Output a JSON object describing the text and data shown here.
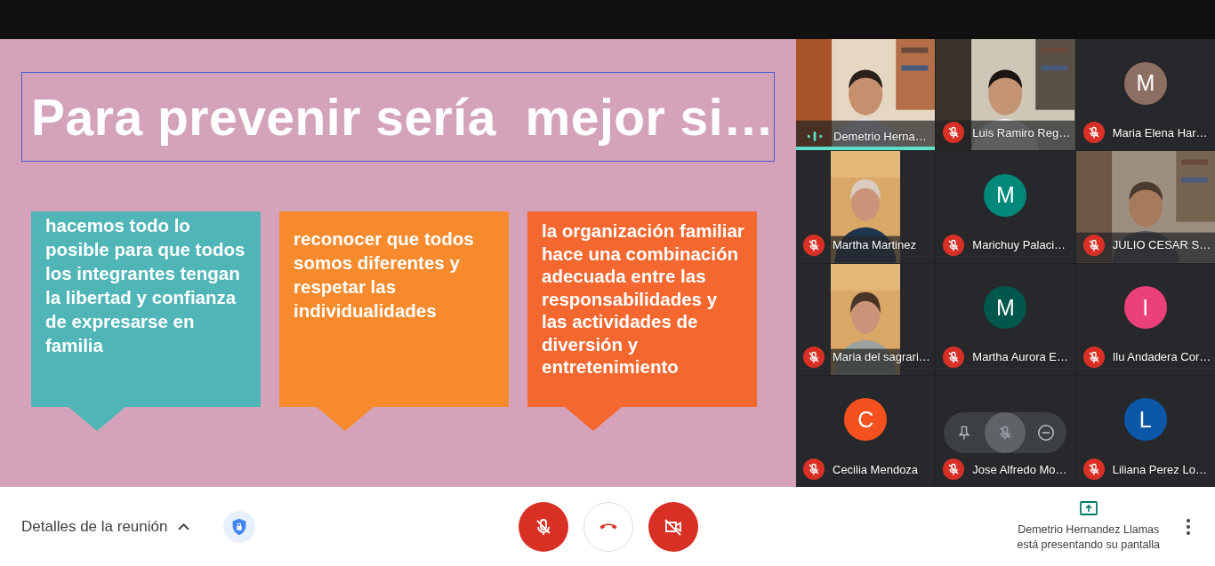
{
  "slide": {
    "title": "Para prevenir sería  mejor si…",
    "title_selected": true,
    "cards": [
      {
        "text": "hacemos todo lo posible para que todos los integrantes tengan la libertad y confianza de expresarse en familia",
        "color": "#4fb5b7"
      },
      {
        "text": "reconocer que todos somos diferentes y respetar las individualidades",
        "color": "#f78a2c"
      },
      {
        "text": "la organización familiar hace una combinación adecuada entre las responsabilidades y las actividades de diversión y entretenimiento",
        "color": "#f4672f"
      }
    ]
  },
  "participants": [
    {
      "name": "Demetrio Herna…",
      "kind": "video",
      "muted": false,
      "speaking": true
    },
    {
      "name": "Luis Ramiro Reg…",
      "kind": "video",
      "muted": true,
      "speaking": false
    },
    {
      "name": "Maria Elena Har…",
      "kind": "avatar",
      "initial": "M",
      "color": "#8d6e63",
      "muted": true,
      "speaking": false
    },
    {
      "name": "Martha Martinez",
      "kind": "portrait",
      "muted": true,
      "speaking": false
    },
    {
      "name": "Marichuy Palaci…",
      "kind": "avatar",
      "initial": "M",
      "color": "#00897b",
      "muted": true,
      "speaking": false
    },
    {
      "name": "JULIO CESAR S…",
      "kind": "video",
      "muted": true,
      "speaking": false
    },
    {
      "name": "Maria del sagrari…",
      "kind": "portrait",
      "muted": true,
      "speaking": false
    },
    {
      "name": "Martha Aurora E…",
      "kind": "avatar",
      "initial": "M",
      "color": "#00574b",
      "muted": true,
      "speaking": false
    },
    {
      "name": "Ilu Andadera Cor…",
      "kind": "avatar",
      "initial": "I",
      "color": "#ec407a",
      "muted": true,
      "speaking": false
    },
    {
      "name": "Cecilia Mendoza",
      "kind": "avatar",
      "initial": "C",
      "color": "#f4511e",
      "muted": true,
      "speaking": false
    },
    {
      "name": "Jose Alfredo Mo…",
      "kind": "hover",
      "muted": true,
      "speaking": false
    },
    {
      "name": "Liliana Perez Lo…",
      "kind": "avatar",
      "initial": "L",
      "color": "#0b57a8",
      "muted": true,
      "speaking": false
    }
  ],
  "bottom_bar": {
    "meeting_details": "Detalles de la reunión",
    "details_expanded": false,
    "controls": [
      {
        "kind": "mic_off"
      },
      {
        "kind": "hang_up"
      },
      {
        "kind": "camera_off"
      }
    ],
    "presenter": "Demetrio Hernandez Llamas",
    "presenting_note": "está presentando su pantalla"
  }
}
